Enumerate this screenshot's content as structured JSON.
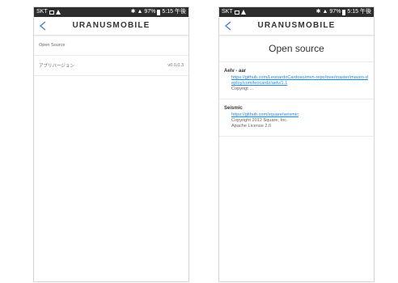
{
  "status_bar": {
    "carrier": "SKT",
    "time": "5:15 午後",
    "battery": "97%"
  },
  "app_bar": {
    "brand": "URANUSMOBILE"
  },
  "left_screen": {
    "rows": [
      {
        "label": "Open Source",
        "value": ""
      },
      {
        "label": "アプリバージョン",
        "value": "v0.0.0.3"
      }
    ]
  },
  "right_screen": {
    "title": "Open source",
    "licenses": [
      {
        "name": "Aelv - aar",
        "link": "https://github.com/LeonardoCardoso/mvn-repo/tree/master/maven-deploy/com/leocardz/aelv/1.1",
        "line1": "Copyrigt ...",
        "line2": ""
      },
      {
        "name": "Seismic",
        "link": "https://github.com/square/seismic",
        "line1": "Copyright 2012 Square, Inc.",
        "line2": "Apache License 2.0"
      }
    ]
  },
  "colors": {
    "link": "#1e88e5",
    "back_icon": "#4a7fd4",
    "status_bar": "#2d2d2d"
  }
}
